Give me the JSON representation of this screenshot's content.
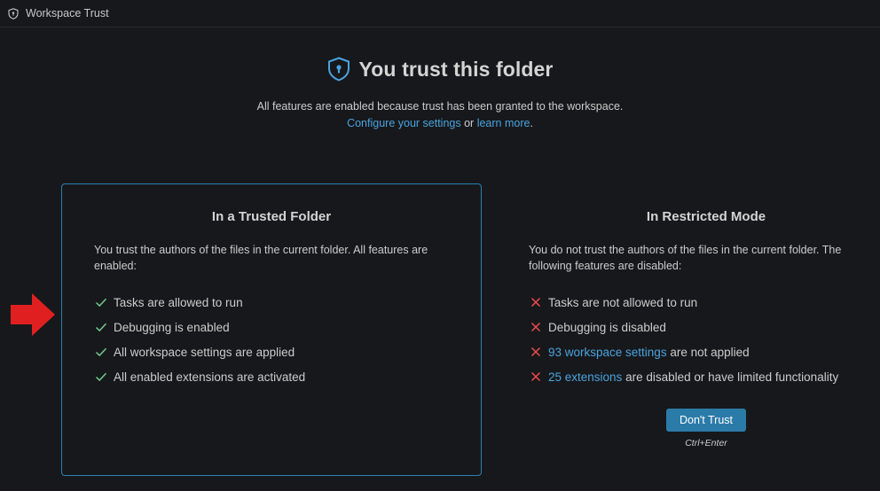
{
  "tab": {
    "label": "Workspace Trust",
    "icon": "shield-icon"
  },
  "header": {
    "title": "You trust this folder",
    "description": "All features are enabled because trust has been granted to the workspace.",
    "configure_link": "Configure your settings",
    "or_text": " or ",
    "learn_link": "learn more",
    "period": "."
  },
  "trusted_card": {
    "title": "In a Trusted Folder",
    "description": "You trust the authors of the files in the current folder. All features are enabled:",
    "items": [
      {
        "text": "Tasks are allowed to run"
      },
      {
        "text": "Debugging is enabled"
      },
      {
        "text": "All workspace settings are applied"
      },
      {
        "text": "All enabled extensions are activated"
      }
    ]
  },
  "restricted_card": {
    "title": "In Restricted Mode",
    "description": "You do not trust the authors of the files in the current folder. The following features are disabled:",
    "items": [
      {
        "text": "Tasks are not allowed to run"
      },
      {
        "text": "Debugging is disabled"
      },
      {
        "link": "93 workspace settings",
        "text": " are not applied"
      },
      {
        "link": "25 extensions",
        "text": " are disabled or have limited functionality"
      }
    ],
    "button_label": "Don't Trust",
    "shortcut": "Ctrl+Enter"
  },
  "colors": {
    "background": "#17181b",
    "accent": "#2b7fb2",
    "link": "#4aa3df",
    "check": "#73c991",
    "cross": "#f14c4c",
    "annotation_arrow": "#e02020"
  }
}
